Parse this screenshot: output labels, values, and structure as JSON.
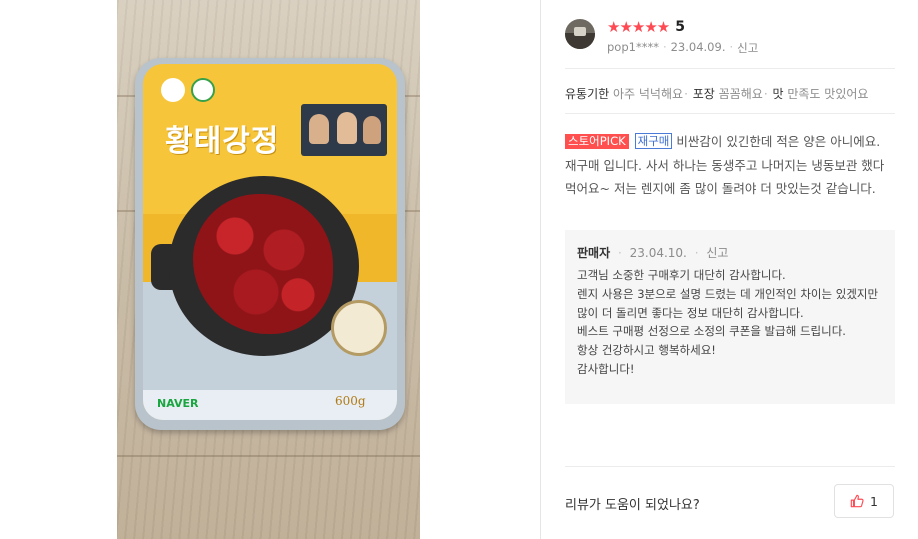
{
  "photo": {
    "package_title": "황태강정",
    "brand_mark": "NAVER",
    "weight": "600g"
  },
  "review": {
    "rating_stars": "★★★★★",
    "rating_value": "5",
    "author": "pop1****",
    "date": "23.04.09.",
    "report_label": "신고",
    "summary": [
      {
        "key": "유통기한",
        "value": "아주 넉넉해요"
      },
      {
        "key": "포장",
        "value": "꼼꼼해요"
      },
      {
        "key": "맛",
        "value": "만족도 맛있어요"
      }
    ],
    "badge_pick": "스토어PICK",
    "badge_repurchase": "재구매",
    "text": "비싼감이 있긴한데 적은 양은 아니에요. 재구매 입니다. 사서 하나는 동생주고 나머지는 냉동보관 했다 먹어요~ 저는 렌지에 좀 많이 돌려야 더 맛있는것 같습니다."
  },
  "seller_reply": {
    "name": "판매자",
    "date": "23.04.10.",
    "report_label": "신고",
    "lines": [
      "고객님 소중한 구매후기 대단히 감사합니다.",
      "렌지 사용은 3분으로 설명 드렸는 데 개인적인 차이는 있겠지만",
      "많이 더 돌리면 좋다는 정보 대단히 감사합니다.",
      "베스트 구매평 선정으로 소정의 쿠폰을 발급해 드립니다.",
      "항상 건강하시고 행복하세요!",
      "감사합니다!"
    ]
  },
  "helpful": {
    "question": "리뷰가 도움이 되었나요?",
    "count": "1"
  },
  "colors": {
    "star": "#ff4a53",
    "badge_pick_bg": "#ff4f4f",
    "badge_repurchase": "#3d6fd0"
  },
  "icons": [
    "thumbs-up-icon",
    "avatar"
  ]
}
